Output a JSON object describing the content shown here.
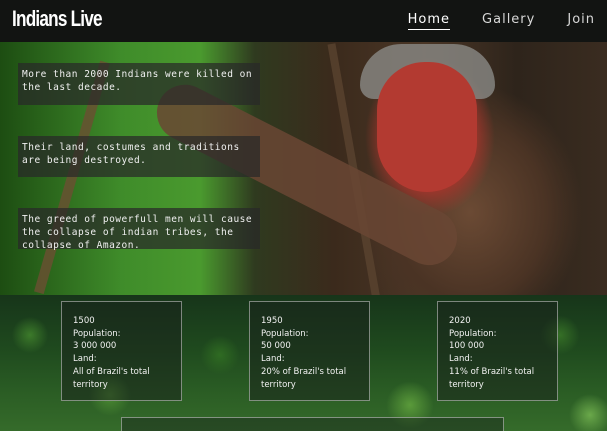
{
  "header": {
    "logo": "Indians Live",
    "nav": [
      {
        "label": "Home",
        "active": true
      },
      {
        "label": "Gallery",
        "active": false
      },
      {
        "label": "Join",
        "active": false
      }
    ]
  },
  "hero": {
    "facts": [
      "More than 2000 Indians were killed on the last decade.",
      "Their land, costumes and traditions are being destroyed.",
      "The greed of powerfull men will cause the collapse of indian tribes, the collapse of Amazon."
    ]
  },
  "stats": [
    {
      "year": "1500",
      "population_label": "Population:",
      "population": "3 000 000",
      "land_label": "Land:",
      "land": "All of Brazil's total territory"
    },
    {
      "year": "1950",
      "population_label": "Population:",
      "population": "50 000",
      "land_label": "Land:",
      "land": "20% of Brazil's total territory"
    },
    {
      "year": "2020",
      "population_label": "Population:",
      "population": "100 000",
      "land_label": "Land:",
      "land": "11% of Brazil's total territory"
    }
  ]
}
